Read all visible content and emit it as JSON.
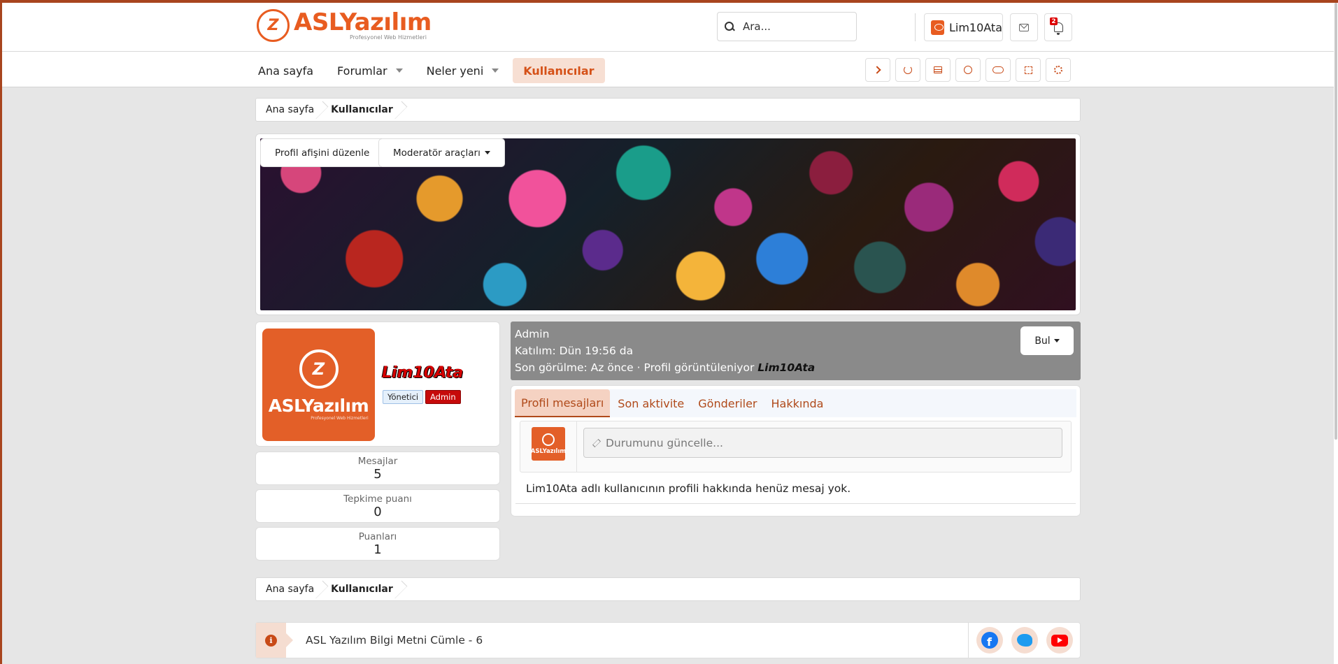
{
  "brand": {
    "name_part1": "ASL",
    "name_part2": "Yazılım",
    "tagline": "Profesyonel Web Hizmetleri",
    "accent_color": "#e85c20"
  },
  "search": {
    "placeholder": "Ara..."
  },
  "user_menu": {
    "username": "Lim10Ata",
    "alerts_count": "2"
  },
  "nav": {
    "items": [
      {
        "label": "Ana sayfa",
        "has_dropdown": false
      },
      {
        "label": "Forumlar",
        "has_dropdown": true
      },
      {
        "label": "Neler yeni",
        "has_dropdown": true
      },
      {
        "label": "Kullanıcılar",
        "active": true
      }
    ],
    "tools": [
      "chevron-right-icon",
      "undo-icon",
      "table-icon",
      "palette-icon",
      "toggle-icon",
      "expand-icon",
      "settings-icon"
    ]
  },
  "breadcrumb": {
    "home": "Ana sayfa",
    "current": "Kullanıcılar"
  },
  "cover": {
    "edit_label": "Profil afişini düzenle",
    "mod_label": "Moderatör araçları"
  },
  "profile": {
    "username": "Lim10Ata",
    "avatar_brand": "ASLYazılım",
    "avatar_tagline": "Profesyonel Web Hizmetleri",
    "banner_staff": "Yönetici",
    "banner_admin": "Admin",
    "title": "Admin",
    "joined": "Katılım: Dün 19:56 da",
    "last_seen_prefix": "Son görülme: Az önce · Profil görüntüleniyor",
    "last_seen_user": "Lim10Ata",
    "find_label": "Bul"
  },
  "stats": [
    {
      "label": "Mesajlar",
      "value": "5"
    },
    {
      "label": "Tepkime puanı",
      "value": "0"
    },
    {
      "label": "Puanları",
      "value": "1"
    }
  ],
  "tabs": [
    "Profil mesajları",
    "Son aktivite",
    "Gönderiler",
    "Hakkında"
  ],
  "status": {
    "placeholder": "Durumunu güncelle...",
    "avatar_text": "ASLYazılım",
    "empty_message": "Lim10Ata adlı kullanıcının profili hakkında henüz mesaj yok."
  },
  "notice": {
    "text": "ASL Yazılım Bilgi Metni Cümle - 6"
  }
}
